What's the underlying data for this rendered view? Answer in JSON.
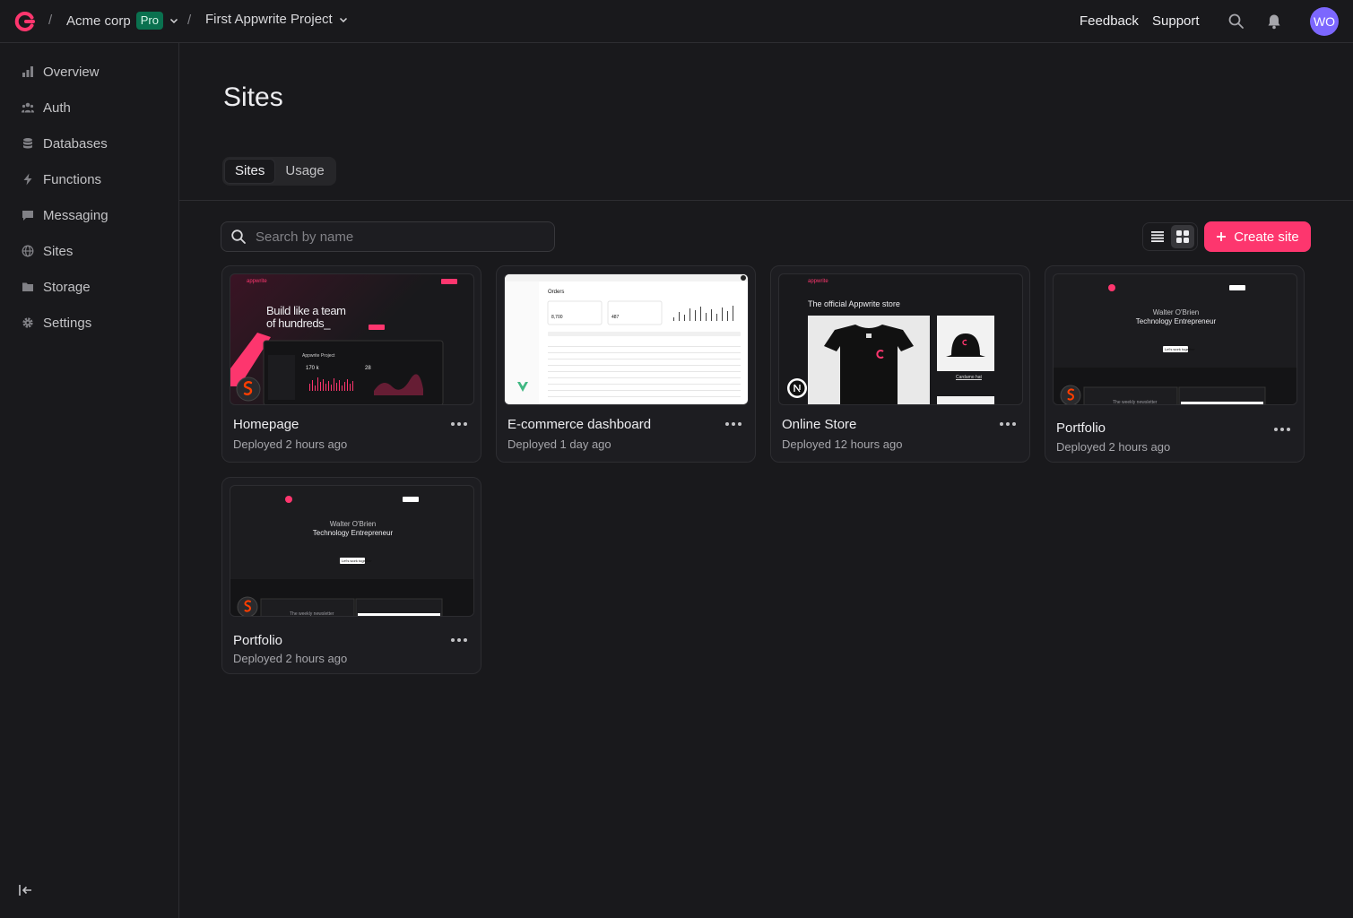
{
  "header": {
    "org_name": "Acme corp",
    "org_badge": "Pro",
    "project_name": "First Appwrite Project",
    "feedback": "Feedback",
    "support": "Support",
    "avatar_initials": "WO"
  },
  "sidebar": {
    "items": [
      {
        "label": "Overview",
        "icon": "chart-icon"
      },
      {
        "label": "Auth",
        "icon": "users-icon"
      },
      {
        "label": "Databases",
        "icon": "database-icon"
      },
      {
        "label": "Functions",
        "icon": "lightning-icon"
      },
      {
        "label": "Messaging",
        "icon": "chat-icon"
      },
      {
        "label": "Sites",
        "icon": "globe-icon"
      },
      {
        "label": "Storage",
        "icon": "folder-icon"
      },
      {
        "label": "Settings",
        "icon": "gear-icon"
      }
    ]
  },
  "page": {
    "title": "Sites",
    "tabs": [
      "Sites",
      "Usage"
    ],
    "search_placeholder": "Search by name",
    "create_label": "Create site"
  },
  "sites": [
    {
      "name": "Homepage",
      "status": "Deployed 2 hours ago",
      "preview": {
        "brand": "appwrite",
        "headline_1": "Build like a team",
        "headline_2": "of hundreds_",
        "project": "Appwrite Project",
        "stat_1": "170 k",
        "stat_2": "28"
      }
    },
    {
      "name": "E-commerce dashboard",
      "status": "Deployed 1 day ago",
      "preview": {
        "heading": "Orders",
        "stat_1": "8,700",
        "stat_2": "487"
      }
    },
    {
      "name": "Online Store",
      "status": "Deployed 12 hours ago",
      "preview": {
        "brand": "appwrite",
        "headline": "The official Appwrite store",
        "product": "Cardamo hat"
      }
    },
    {
      "name": "Portfolio",
      "status": "Deployed 2 hours ago",
      "preview": {
        "person": "Walter O'Brien",
        "role": "Technology Entrepreneur",
        "cta": "Let's work together",
        "newsletter": "The weekly newsletter"
      }
    },
    {
      "name": "Portfolio",
      "status": "Deployed 2 hours ago",
      "preview": {
        "person": "Walter O'Brien",
        "role": "Technology Entrepreneur",
        "cta": "Let's work together",
        "newsletter": "The weekly newsletter"
      }
    }
  ],
  "colors": {
    "accent": "#fd366e",
    "background": "#19191c",
    "pro_badge": "#0a714f",
    "avatar": "#7c67fe"
  }
}
